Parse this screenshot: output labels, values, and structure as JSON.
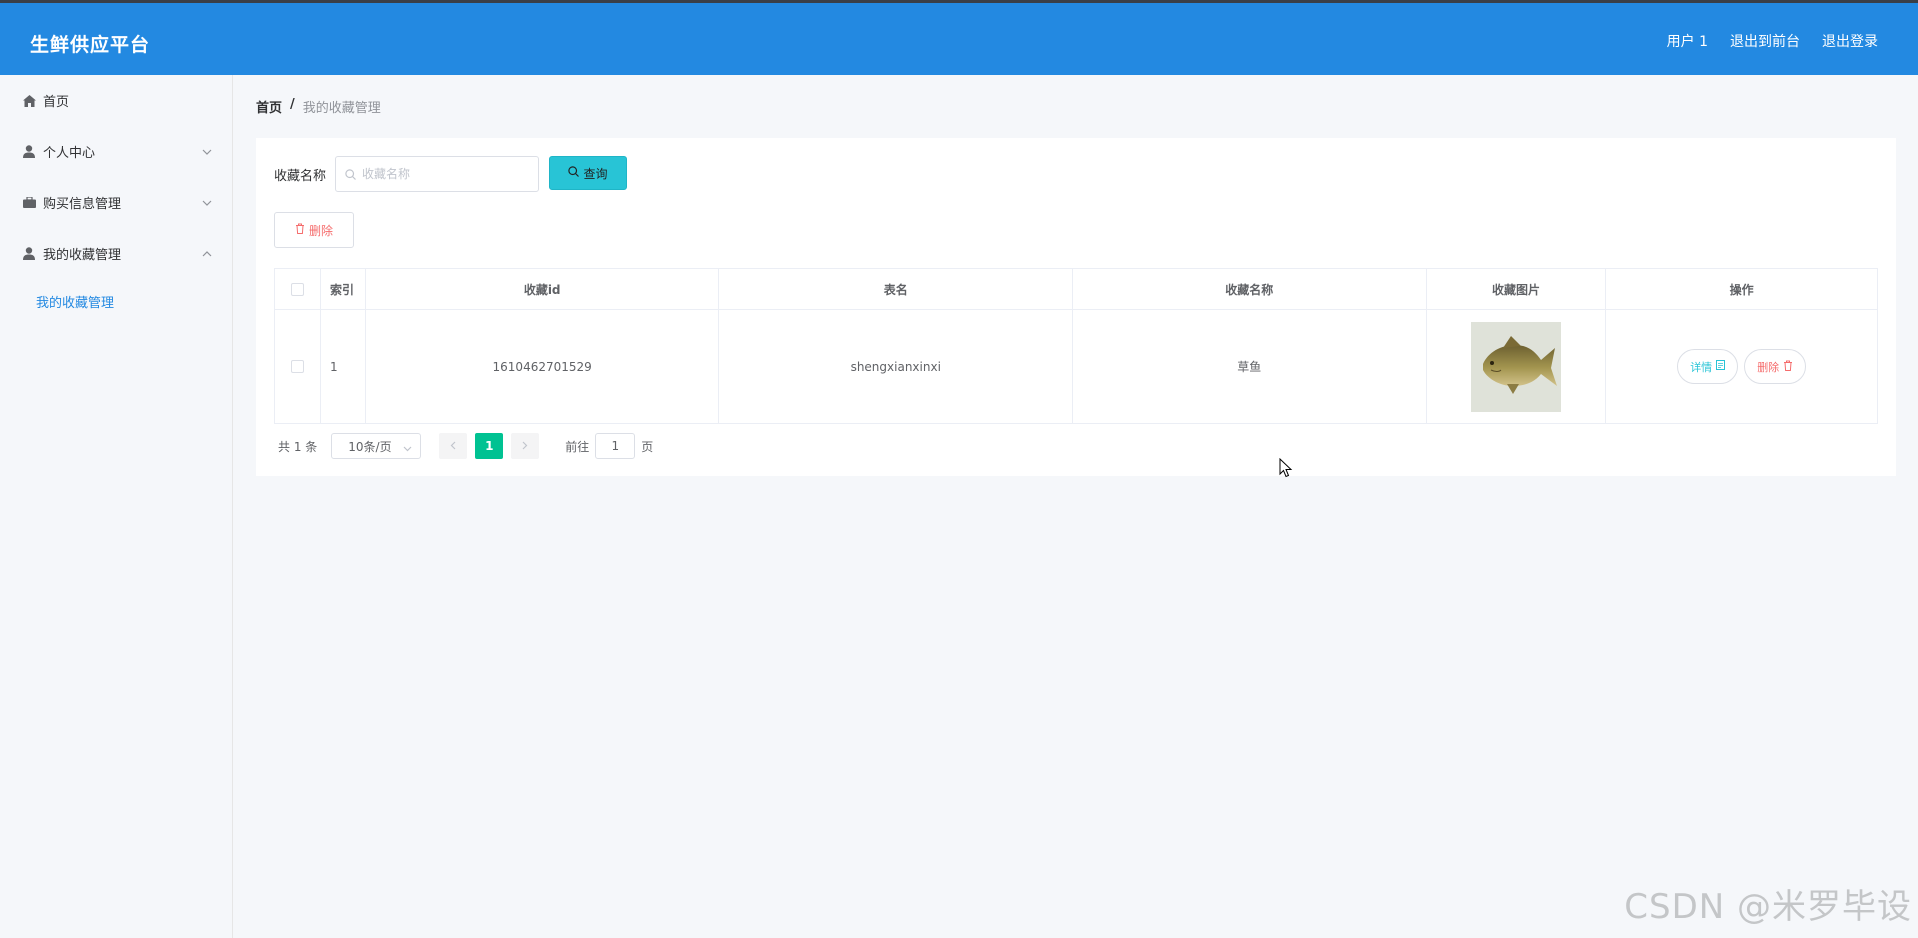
{
  "header": {
    "logo": "生鲜供应平台",
    "user": "用户 1",
    "back_to_front": "退出到前台",
    "logout": "退出登录"
  },
  "sidebar": {
    "items": [
      {
        "label": "首页",
        "icon": "home-icon"
      },
      {
        "label": "个人中心",
        "icon": "user-icon"
      },
      {
        "label": "购买信息管理",
        "icon": "briefcase-icon"
      },
      {
        "label": "我的收藏管理",
        "icon": "user-icon"
      }
    ],
    "subitem": "我的收藏管理"
  },
  "breadcrumb": {
    "home": "首页",
    "sep": "/",
    "current": "我的收藏管理"
  },
  "search": {
    "label": "收藏名称",
    "placeholder": "收藏名称",
    "button": "查询"
  },
  "toolbar": {
    "delete": "删除"
  },
  "table": {
    "headers": [
      "索引",
      "收藏id",
      "表名",
      "收藏名称",
      "收藏图片",
      "操作"
    ],
    "rows": [
      {
        "index": "1",
        "id": "1610462701529",
        "table_name": "shengxianxinxi",
        "name": "草鱼",
        "detail": "详情",
        "delete": "删除"
      }
    ]
  },
  "pagination": {
    "total": "共 1 条",
    "page_size": "10条/页",
    "current_page": "1",
    "goto_label": "前往",
    "goto_value": "1",
    "goto_suffix": "页"
  },
  "watermark": "CSDN @米罗毕设",
  "colors": {
    "header": "#2389e1",
    "query_button": "#28c4d6",
    "active_page": "#00c292",
    "danger": "#f56c6c"
  }
}
